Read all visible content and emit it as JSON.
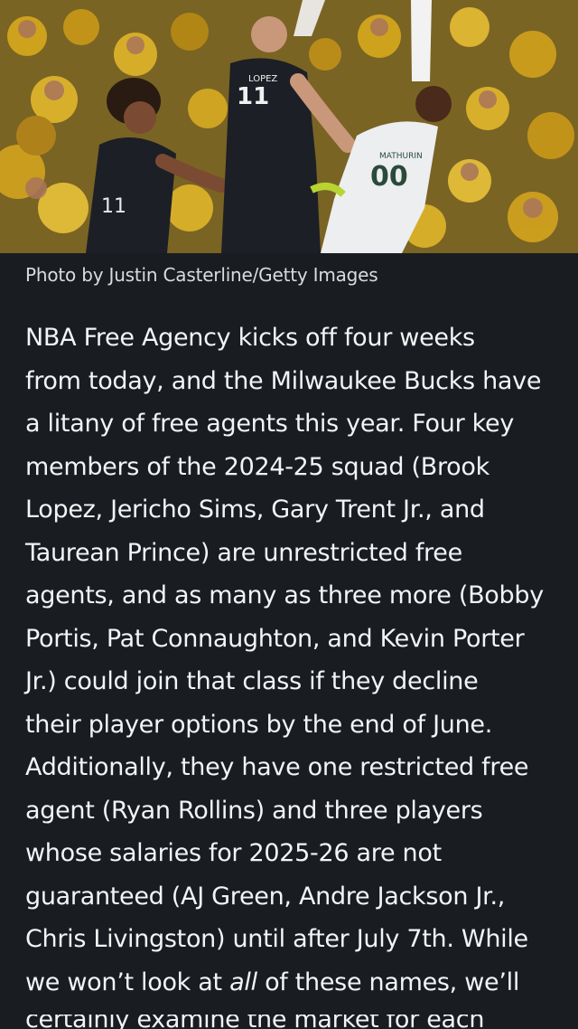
{
  "photo": {
    "description_icon": "basketball-game-photo",
    "jersey_left": "11",
    "jersey_right": "00",
    "jersey_right_name": "MATHURIN",
    "jersey_center_name": "LOPEZ",
    "jersey_center": "11"
  },
  "caption": "Photo by Justin Casterline/Getty Images",
  "article": {
    "lines": [
      "NBA Free Agency kicks off four weeks",
      "from today, and the Milwaukee Bucks have",
      "a litany of free agents this year. Four key",
      "members of the 2024-25 squad (Brook",
      "Lopez, Jericho Sims, Gary Trent Jr., and",
      "Taurean Prince) are unrestricted free",
      "agents, and as many as three more (Bobby",
      "Portis, Pat Connaughton, and Kevin Porter",
      "Jr.) could join that class if they decline",
      "their player options by the end of June.",
      "Additionally, they have one restricted free",
      "agent (Ryan Rollins) and three players",
      "whose salaries for 2025-26 are not",
      "guaranteed (AJ Green, Andre Jackson Jr.,",
      "Chris Livingston) until after July 7th. While"
    ],
    "last_line_pre": "we won’t look at ",
    "last_line_em": "all",
    "last_line_post": " of these names, we’ll",
    "cut_line": "certainly examine the market for each"
  }
}
